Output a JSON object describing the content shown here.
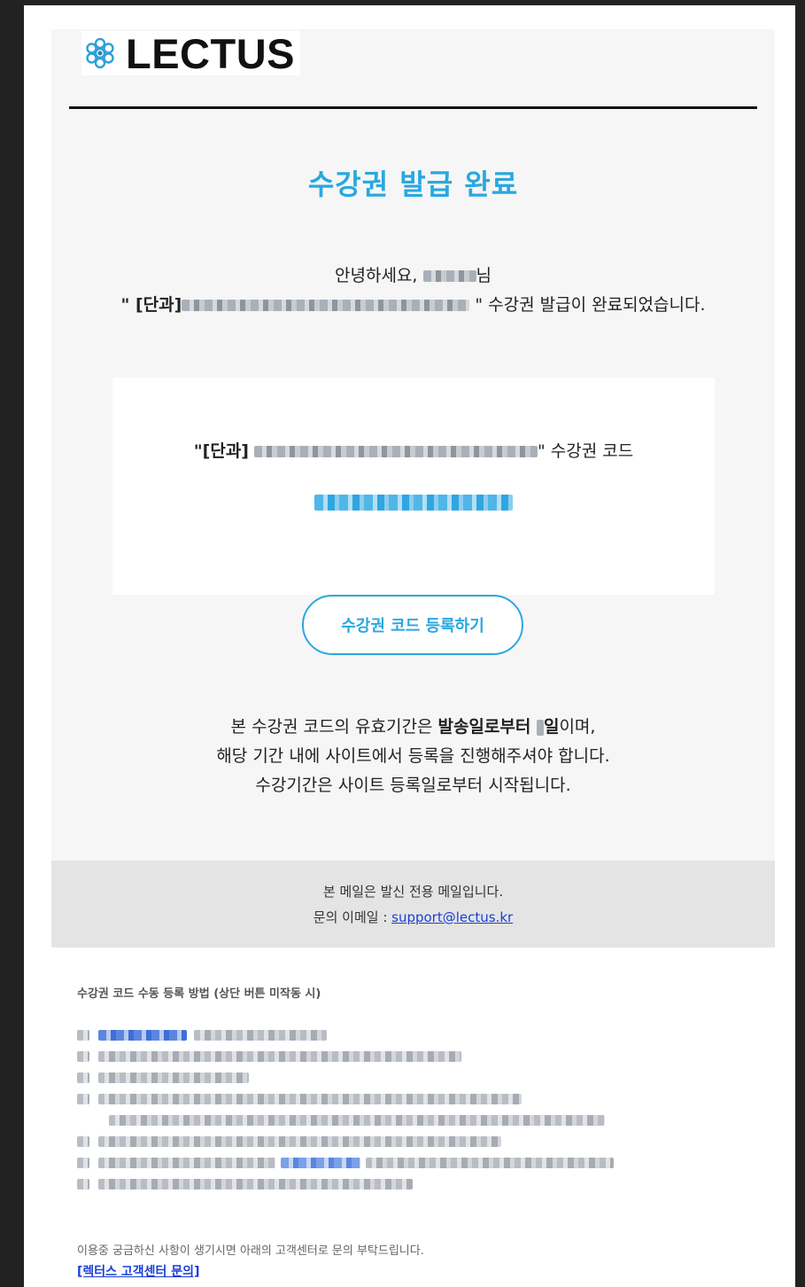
{
  "brand": {
    "name": "LECTUS",
    "logo_icon": "flower-logo-icon",
    "accent": "#29a8e0"
  },
  "email": {
    "title": "수강권 발급 완료",
    "greeting_prefix": "안녕하세요,",
    "greeting_suffix": "님",
    "issued_prefix": "\" [단과]",
    "issued_suffix": " \" 수강권 발급이 완료되었습니다.",
    "code_prefix": "\"[단과]",
    "code_suffix": "\" 수강권 코드",
    "register_button": "수강권 코드 등록하기",
    "notice_line1_before": "본 수강권 코드의 유효기간은 ",
    "notice_line1_bold_a": "발송일로부터 ",
    "notice_line1_bold_b": "일",
    "notice_line1_after": "이며,",
    "notice_line2": "해당 기간 내에 사이트에서 등록을 진행해주셔야 합니다.",
    "notice_line3": "수강기간은 사이트 등록일로부터 시작됩니다."
  },
  "footer": {
    "line1": "본 메일은 발신 전용 메일입니다.",
    "contact_label": "문의 이메일 : ",
    "contact_email": "support@lectus.kr"
  },
  "manual": {
    "title": "수강권 코드 수동 등록 방법 (상단 버튼 미작동 시)",
    "bottom_note": "이용중 궁금하신 사항이 생기시면 아래의 고객센터로 문의 부탁드립니다.",
    "bottom_link": "[렉터스 고객센터 문의]"
  }
}
